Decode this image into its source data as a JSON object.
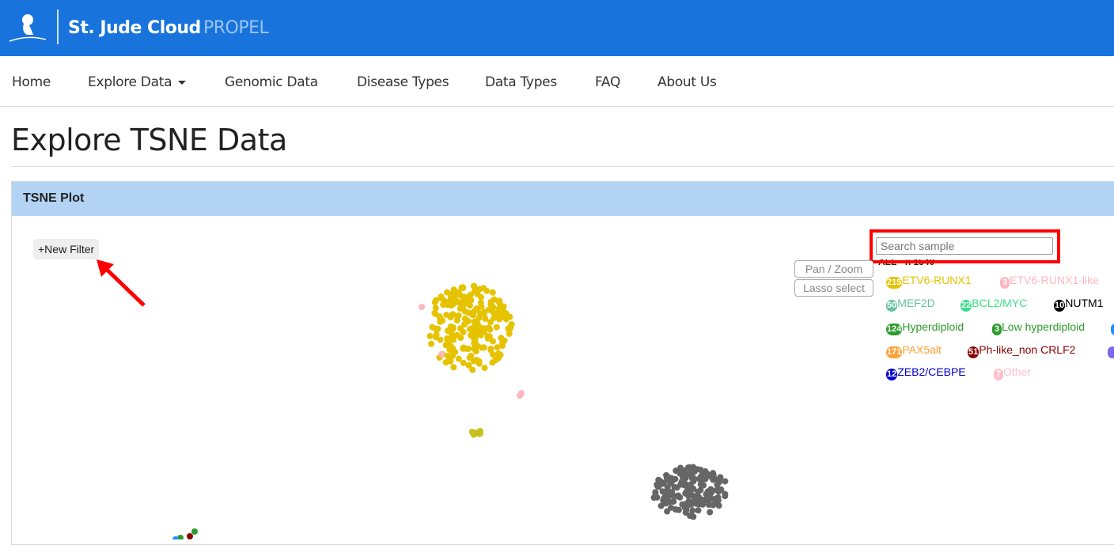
{
  "header": {
    "brand": "St. Jude Cloud",
    "product": "PROPEL",
    "accent": "#1874DC"
  },
  "nav": [
    {
      "label": "Home"
    },
    {
      "label": "Explore Data",
      "dropdown": true
    },
    {
      "label": "Genomic Data"
    },
    {
      "label": "Disease Types"
    },
    {
      "label": "Data Types"
    },
    {
      "label": "FAQ"
    },
    {
      "label": "About Us"
    }
  ],
  "page_title": "Explore TSNE Data",
  "panel": {
    "title": "TSNE Plot",
    "new_filter": "+New Filter",
    "search_placeholder": "Search sample",
    "all_label": "ALL - n 1540",
    "pan_zoom": "Pan / Zoom",
    "lasso": "Lasso select"
  },
  "legend": [
    {
      "count": "215",
      "label": "ETV6-RUNX1",
      "color": "#E6C300"
    },
    {
      "count": "3",
      "label": "ETV6-RUNX1-like",
      "color": "#FFB6C1"
    },
    {
      "count": "50",
      "label": "MEF2D",
      "color": "#66C2A5"
    },
    {
      "count": "22",
      "label": "BCL2/MYC",
      "color": "#3CE08A"
    },
    {
      "count": "10",
      "label": "NUTM1",
      "color": "#000000"
    },
    {
      "count": "124",
      "label": "Hyperdiploid",
      "color": "#2E9B2E"
    },
    {
      "count": "3",
      "label": "Low hyperdiploid",
      "color": "#2E9B2E"
    },
    {
      "count": "171",
      "label": "PAX5alt",
      "color": "#FFA033"
    },
    {
      "count": "51",
      "label": "Ph-like_non CRLF2",
      "color": "#8B0000"
    },
    {
      "count": "12",
      "label": "ZEB2/CEBPE",
      "color": "#0000CD"
    },
    {
      "count": "7",
      "label": "Other",
      "color": "#FFC0CB"
    }
  ]
}
